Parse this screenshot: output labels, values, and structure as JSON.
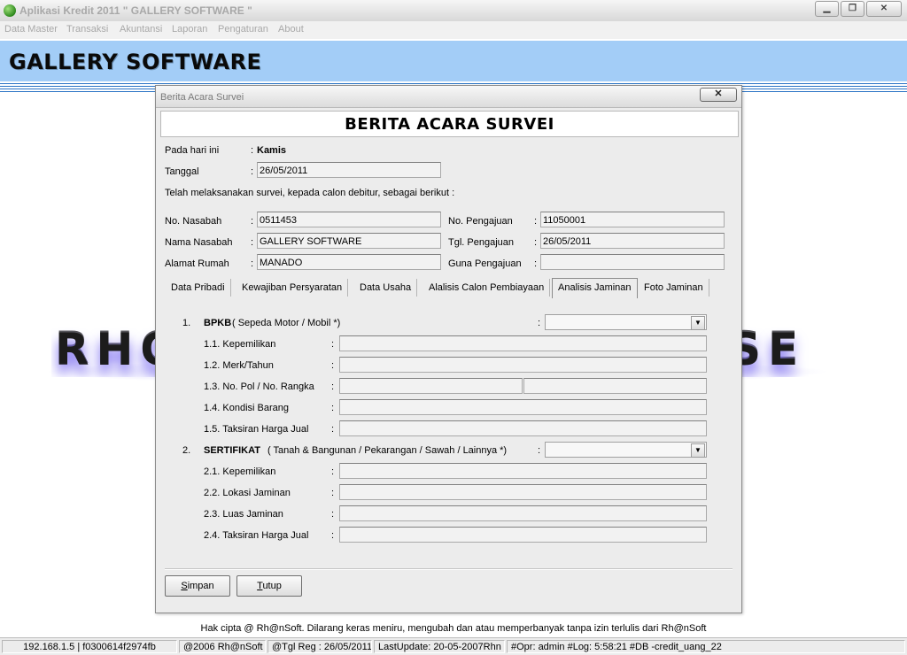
{
  "app": {
    "title": "Aplikasi Kredit 2011 \" GALLERY SOFTWARE \"",
    "window_buttons": {
      "minimize": "▁",
      "maximize": "❐",
      "close": "✕"
    }
  },
  "menu": [
    "Data Master",
    "Transaksi",
    "Akuntansi",
    "Laporan",
    "Pengaturan",
    "About"
  ],
  "banner": {
    "brand": "GALLERY SOFTWARE"
  },
  "watermark": {
    "left": "RHO",
    "right": "SE"
  },
  "dialog": {
    "title": "Berita Acara Survei",
    "close_label": "✕",
    "heading": "BERITA ACARA SURVEI",
    "hari_label": "Pada hari ini",
    "hari_value": "Kamis",
    "tanggal_label": "Tanggal",
    "tanggal_value": "26/05/2011",
    "intro": "Telah melaksanakan survei, kepada calon debitur, sebagai berikut :",
    "no_nasabah_label": "No. Nasabah",
    "no_nasabah_value": "0511453",
    "nama_nasabah_label": "Nama Nasabah",
    "nama_nasabah_value": "GALLERY SOFTWARE",
    "alamat_label": "Alamat Rumah",
    "alamat_value": "MANADO",
    "no_pengajuan_label": "No. Pengajuan",
    "no_pengajuan_value": "11050001",
    "tgl_pengajuan_label": "Tgl. Pengajuan",
    "tgl_pengajuan_value": "26/05/2011",
    "guna_label": "Guna Pengajuan",
    "guna_value": "",
    "colon": ":",
    "tabs": [
      "Data Pribadi",
      "Kewajiban Persyaratan",
      "Data Usaha",
      "Alalisis Calon Pembiayaan",
      "Analisis Jaminan",
      "Foto Jaminan"
    ],
    "active_tab": "Analisis Jaminan",
    "bpkb": {
      "num": "1.",
      "title": "BPKB",
      "sub": "( Sepeda Motor / Mobil *)",
      "rows": [
        "1.1. Kepemilikan",
        "1.2. Merk/Tahun",
        "1.3. No. Pol / No. Rangka",
        "1.4. Kondisi Barang",
        "1.5. Taksiran Harga Jual"
      ]
    },
    "sertifikat": {
      "num": "2.",
      "title": "SERTIFIKAT",
      "sub": "( Tanah & Bangunan / Pekarangan / Sawah / Lainnya *)",
      "rows": [
        "2.1. Kepemilikan",
        "2.2. Lokasi Jaminan",
        "2.3. Luas Jaminan",
        "2.4. Taksiran Harga Jual"
      ]
    },
    "combo_arrow": "▼",
    "buttons": {
      "simpan_first": "S",
      "simpan_rest": "impan",
      "tutup_first": "T",
      "tutup_rest": "utup"
    }
  },
  "footer": {
    "copyright": "Hak cipta @ Rh@nSoft. Dilarang keras meniru, mengubah dan atau memperbanyak tanpa izin terlulis dari Rh@nSoft"
  },
  "status": [
    "192.168.1.5 | f0300614f2974fb",
    "@2006 Rh@nSoft",
    "@Tgl Reg : 26/05/2011",
    "LastUpdate: 20-05-2007Rhn",
    "#Opr: admin #Log: 5:58:21 #DB -credit_uang_22"
  ]
}
